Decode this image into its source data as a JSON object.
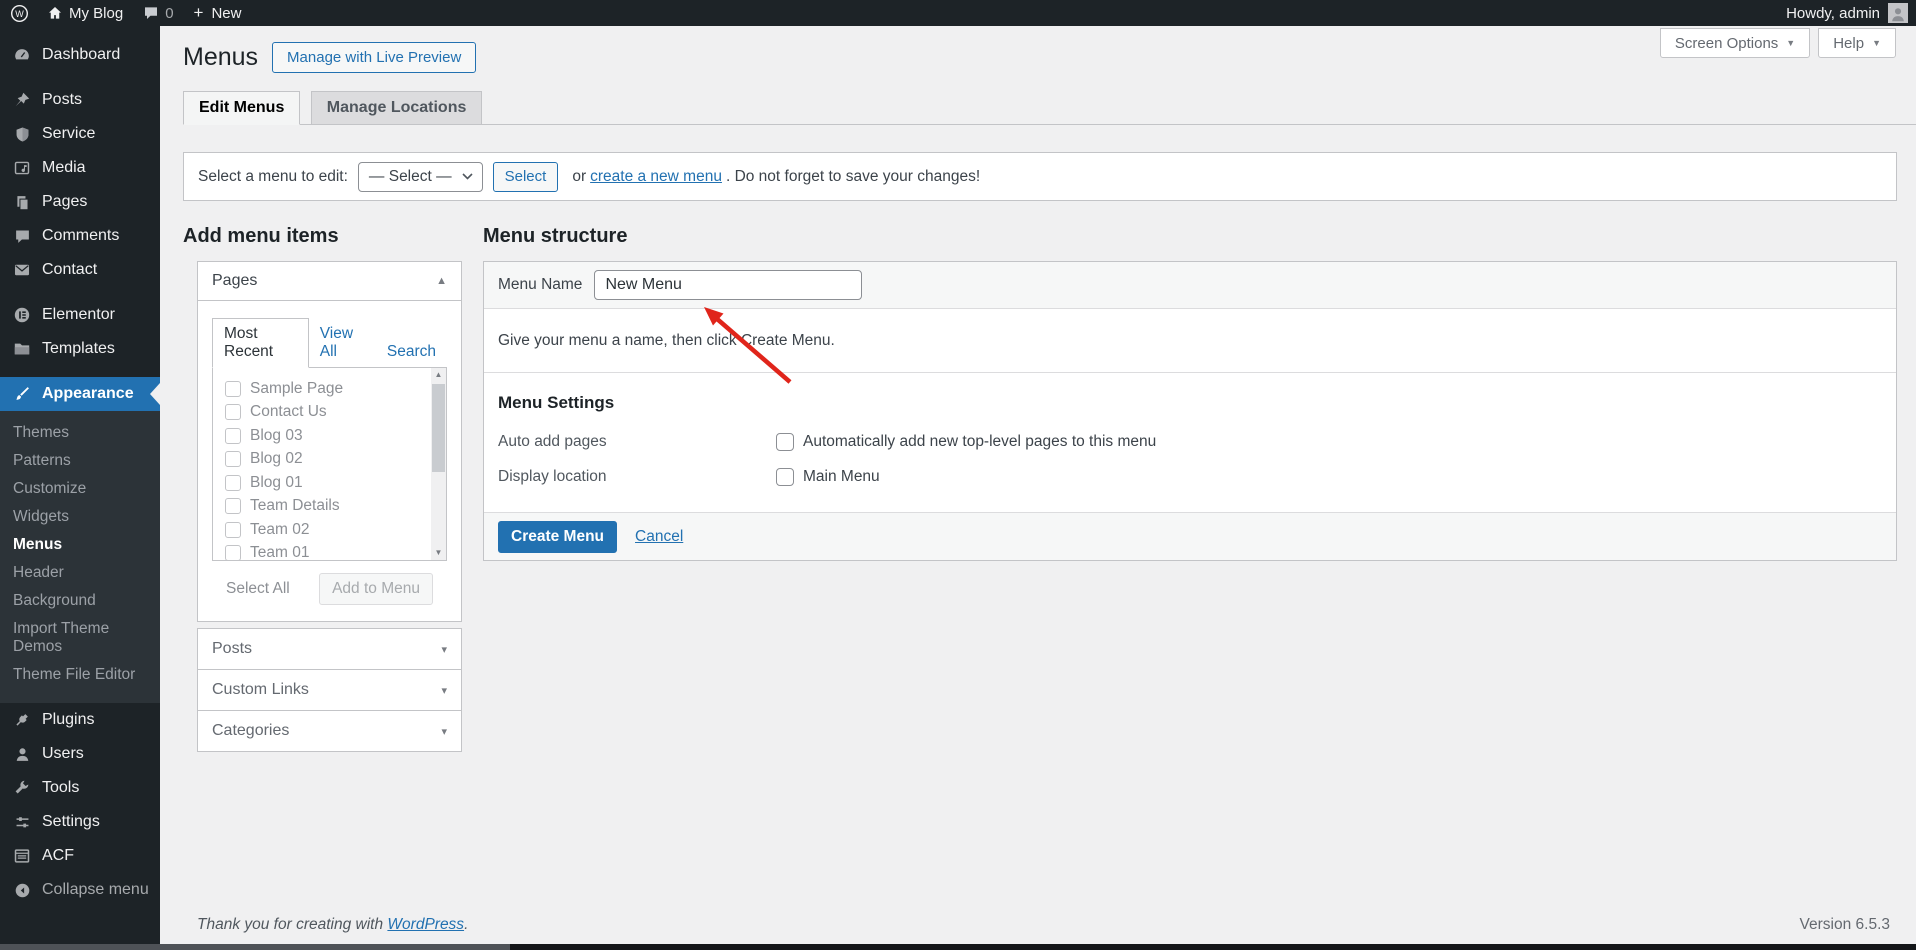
{
  "admin_bar": {
    "site_name": "My Blog",
    "comment_count": "0",
    "new_label": "New",
    "howdy": "Howdy, admin",
    "wp_logo_glyph": "W"
  },
  "icons": {
    "caret_down": "▼",
    "caret_down_small": "▾",
    "caret_up_small": "▲",
    "scroll_up": "▲",
    "scroll_down": "▼",
    "plus": "+"
  },
  "sidebar": {
    "items": [
      {
        "label": "Dashboard"
      },
      {
        "label": "Posts"
      },
      {
        "label": "Service"
      },
      {
        "label": "Media"
      },
      {
        "label": "Pages"
      },
      {
        "label": "Comments"
      },
      {
        "label": "Contact"
      },
      {
        "label": "Elementor"
      },
      {
        "label": "Templates"
      },
      {
        "label": "Appearance"
      },
      {
        "label": "Plugins"
      },
      {
        "label": "Users"
      },
      {
        "label": "Tools"
      },
      {
        "label": "Settings"
      },
      {
        "label": "ACF"
      }
    ],
    "appearance_submenu": [
      "Themes",
      "Patterns",
      "Customize",
      "Widgets",
      "Menus",
      "Header",
      "Background",
      "Import Theme Demos",
      "Theme File Editor"
    ],
    "collapse_label": "Collapse menu"
  },
  "page": {
    "title": "Menus",
    "live_preview_button": "Manage with Live Preview",
    "screen_options": "Screen Options",
    "help": "Help",
    "tabs": [
      "Edit Menus",
      "Manage Locations"
    ],
    "select_bar": {
      "label": "Select a menu to edit:",
      "select_value": "— Select —",
      "select_button": "Select",
      "or_text": "or ",
      "create_link": "create a new menu",
      "after_text": ". Do not forget to save your changes!"
    }
  },
  "add_menu_items": {
    "heading": "Add menu items",
    "pages_panel": {
      "title": "Pages",
      "tab_most_recent": "Most Recent",
      "tab_view_all": "View All",
      "tab_search": "Search",
      "items": [
        "Sample Page",
        "Contact Us",
        "Blog 03",
        "Blog 02",
        "Blog 01",
        "Team Details",
        "Team 02",
        "Team 01"
      ],
      "select_all": "Select All",
      "add_to_menu": "Add to Menu"
    },
    "collapsed_panels": [
      "Posts",
      "Custom Links",
      "Categories"
    ]
  },
  "menu_structure": {
    "heading": "Menu structure",
    "menu_name_label": "Menu Name",
    "menu_name_value": "New Menu",
    "helper_text": "Give your menu a name, then click Create Menu.",
    "settings_heading": "Menu Settings",
    "auto_add_label": "Auto add pages",
    "auto_add_checkbox_label": "Automatically add new top-level pages to this menu",
    "display_location_label": "Display location",
    "display_location_checkbox_label": "Main Menu",
    "create_button": "Create Menu",
    "cancel_link": "Cancel"
  },
  "footer": {
    "thanks_prefix": "Thank you for creating with ",
    "wordpress_link": "WordPress",
    "thanks_suffix": ".",
    "version": "Version 6.5.3"
  },
  "colors": {
    "accent": "#2271b1",
    "admin_dark": "#1d2327",
    "submenu_bg": "#2c3338",
    "page_bg": "#f0f0f1",
    "border": "#c3c4c7",
    "annotation_arrow_red": "#e0251b"
  }
}
